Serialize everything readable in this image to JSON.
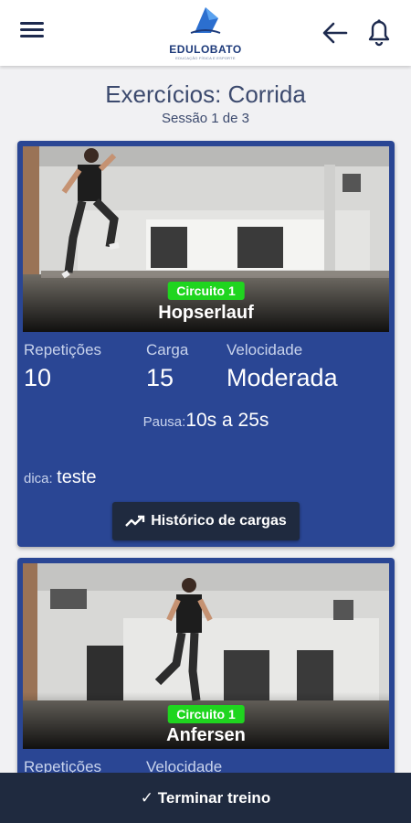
{
  "header": {
    "menu_icon": "menu-icon",
    "logo_text": "EDULOBATO",
    "logo_subtitle": "EDUCAÇÃO FÍSICA E ESPORTE",
    "back_icon": "arrow-left-icon",
    "bell_icon": "bell-icon"
  },
  "page": {
    "title": "Exercícios: Corrida",
    "session": "Sessão 1 de 3"
  },
  "exercises": [
    {
      "circuit": "Circuito 1",
      "name": "Hopserlauf",
      "reps_label": "Repetições",
      "reps_value": "10",
      "load_label": "Carga",
      "load_value": "15",
      "speed_label": "Velocidade",
      "speed_value": "Moderada",
      "pause_label": "Pausa:",
      "pause_value": "10s a 25s",
      "tip_label": "dica:",
      "tip_value": "teste",
      "history_button": "Histórico de cargas",
      "history_icon": "trending-up-icon"
    },
    {
      "circuit": "Circuito 1",
      "name": "Anfersen",
      "reps_label": "Repetições",
      "speed_label": "Velocidade"
    }
  ],
  "footer": {
    "finish_button": "✓ Terminar treino"
  },
  "colors": {
    "card": "#2a4694",
    "circuit_badge": "#1fd51f",
    "dark_button": "#1f2a3f",
    "title_text": "#3c4a6e"
  }
}
